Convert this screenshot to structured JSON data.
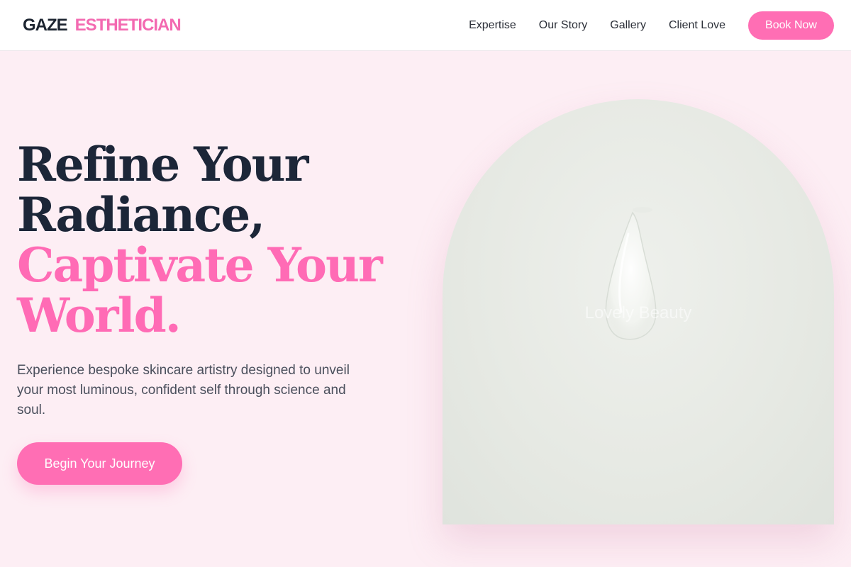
{
  "header": {
    "logo_primary": "GAZE",
    "logo_secondary": "ESTHETICIAN",
    "nav": [
      {
        "label": "Expertise"
      },
      {
        "label": "Our Story"
      },
      {
        "label": "Gallery"
      },
      {
        "label": "Client Love"
      }
    ],
    "book_label": "Book Now"
  },
  "hero": {
    "title_line1": "Refine Your",
    "title_line2": "Radiance,",
    "title_accent1": "Captivate Your",
    "title_accent2": "World.",
    "subtitle": "Experience bespoke skincare artistry designed to unveil your most luminous, confident self through science and soul.",
    "cta_label": "Begin Your Journey",
    "image_watermark": "Lovely Beauty"
  },
  "colors": {
    "accent": "#ff6eb4",
    "brand_dark": "#1c2638",
    "background": "#fdeef4"
  },
  "icons": {
    "hero_image": "skincare-gel-swatch-image"
  }
}
